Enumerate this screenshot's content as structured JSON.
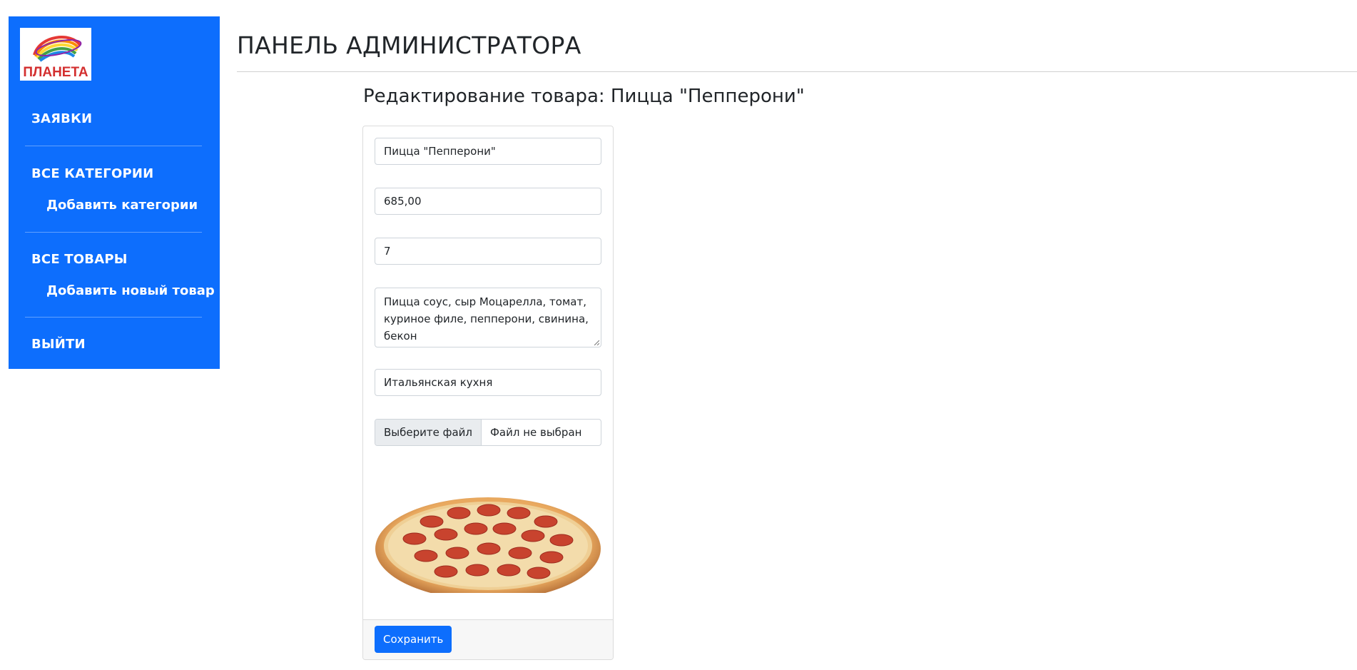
{
  "brand": {
    "logo_text": "ПЛАНЕТА"
  },
  "sidebar": {
    "items": [
      {
        "label": "ЗАЯВКИ"
      },
      {
        "label": "ВСЕ КАТЕГОРИИ",
        "sub": "Добавить категории"
      },
      {
        "label": "ВСЕ ТОВАРЫ",
        "sub": "Добавить новый товар"
      },
      {
        "label": "ВЫЙТИ"
      }
    ],
    "color": "#0d6efd"
  },
  "header": {
    "title": "ПАНЕЛЬ АДМИНИСТРАТОРА"
  },
  "form": {
    "heading": "Редактирование товара: Пицца \"Пепперони\"",
    "name": "Пицца \"Пепперони\"",
    "price": "685,00",
    "quantity": "7",
    "description": "Пицца соус, сыр Моцарелла, томат, куриное филе, пепперони, свинина, бекон",
    "category": "Итальянская кухня",
    "file_button": "Выберите файл",
    "file_status": "Файл не выбран",
    "save_label": "Сохранить"
  }
}
